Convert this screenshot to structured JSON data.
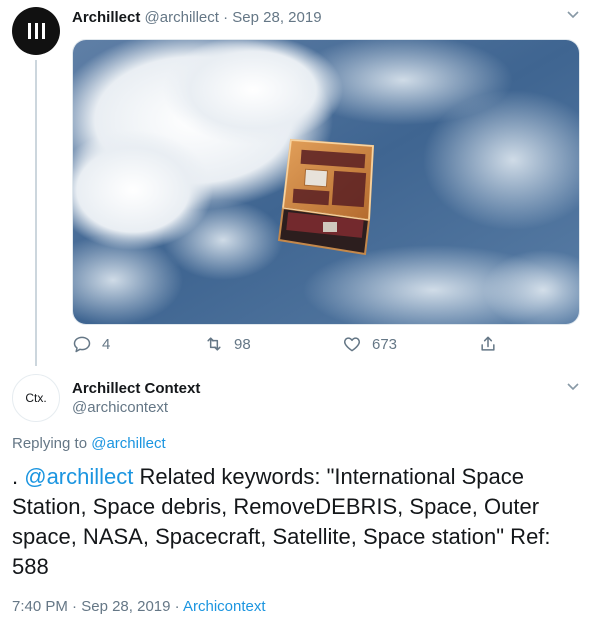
{
  "tweet1": {
    "author_name": "Archillect",
    "author_handle": "@archillect",
    "separator": "·",
    "date": "Sep 28, 2019",
    "image_alt": "satellite above earth clouds",
    "icons": {
      "avatar": "archillect-logo-icon",
      "menu": "chevron-down-icon",
      "reply": "reply-icon",
      "retweet": "retweet-icon",
      "like": "heart-icon",
      "share": "share-icon"
    },
    "counts": {
      "replies": "4",
      "retweets": "98",
      "likes": "673"
    }
  },
  "tweet2": {
    "avatar_text": "Ctx.",
    "author_name": "Archillect Context",
    "author_handle": "@archicontext",
    "replying_label": "Replying to",
    "replying_handle": "@archillect",
    "body_prefix": ". ",
    "body_mention": "@archillect",
    "body_text": " Related keywords: \"International Space Station, Space debris, RemoveDEBRIS, Space, Outer space, NASA, Spacecraft, Satellite, Space station\" Ref: 588",
    "time": "7:40 PM",
    "dot1": " · ",
    "date": "Sep 28, 2019",
    "dot2": " · ",
    "source": "Archicontext"
  },
  "colors": {
    "link": "#1b95e0",
    "muted": "#657786",
    "text": "#14171a",
    "line": "#ccd6dd"
  }
}
